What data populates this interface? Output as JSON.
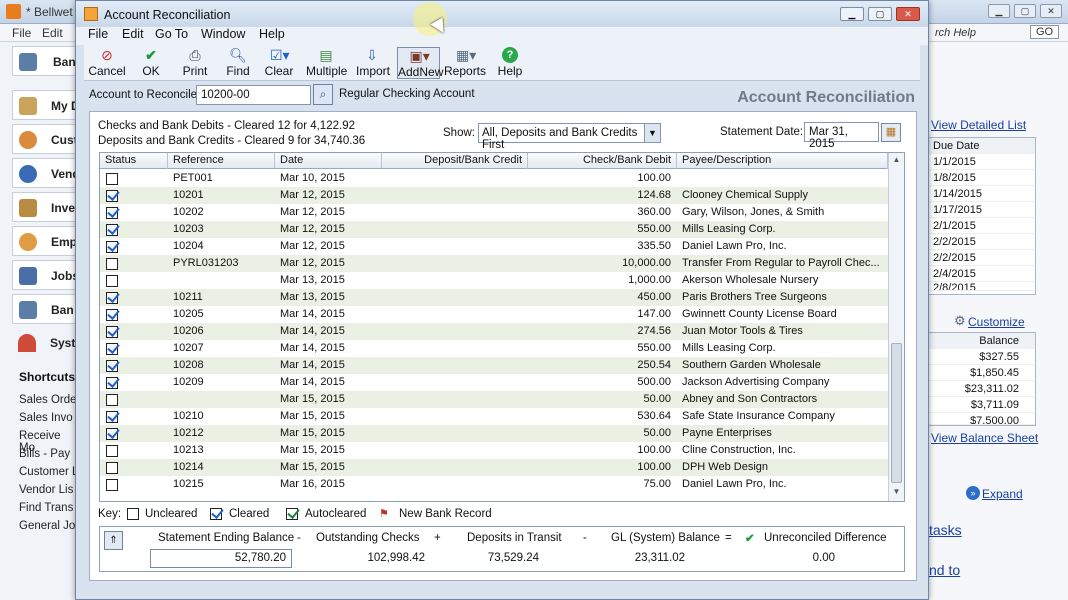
{
  "background_app": {
    "title": "* Bellwet",
    "menu": [
      "File",
      "Edit"
    ],
    "nav_items": [
      "My D",
      "Cust",
      "Vend",
      "Inve",
      "Emp",
      "Jobs",
      "Ban",
      "Syst"
    ],
    "nav_top_label": "Ban",
    "shortcuts_heading": "Shortcuts",
    "shortcuts": [
      "Sales Orde",
      "Sales Invo",
      "Receive Mo",
      "Bills - Pay",
      "Customer L",
      "Vendor Lis",
      "Find Trans",
      "General Jo"
    ],
    "search_help": "rch Help",
    "go_label": "GO",
    "view_detailed_list": "View Detailed List",
    "due_date_header": "Due Date",
    "due_dates": [
      "1/1/2015",
      "1/8/2015",
      "1/14/2015",
      "1/17/2015",
      "2/1/2015",
      "2/2/2015",
      "2/2/2015",
      "2/4/2015",
      "2/8/2015"
    ],
    "customize_label": "Customize",
    "balance_header": "Balance",
    "balances": [
      "$327.55",
      "$1,850.45",
      "$23,311.02",
      "$3,711.09",
      "$7,500.00"
    ],
    "view_balance_sheet": "View Balance Sheet",
    "expand_label": "Expand",
    "tasks_label": "tasks",
    "nd_to_label": "nd to"
  },
  "dialog": {
    "title": "Account Reconciliation",
    "menu": {
      "file": "File",
      "edit": "Edit",
      "goto": "Go To",
      "window": "Window",
      "help": "Help"
    },
    "toolbar": {
      "cancel": "Cancel",
      "ok": "OK",
      "print": "Print",
      "find": "Find",
      "clear": "Clear",
      "multiple": "Multiple",
      "import": "Import",
      "addnew": "AddNew",
      "reports": "Reports",
      "help": "Help"
    },
    "account_label": "Account to Reconcile:",
    "account_value": "10200-00",
    "account_name": "Regular Checking Account",
    "heading": "Account Reconciliation",
    "summary_checks": "Checks and Bank Debits  -  Cleared 12 for 4,122.92",
    "summary_deposits": "Deposits and Bank Credits - Cleared 9 for 34,740.36",
    "show_label": "Show:",
    "show_value": "All, Deposits and Bank Credits First",
    "statement_date_label": "Statement Date:",
    "statement_date": "Mar 31, 2015",
    "columns": {
      "status": "Status",
      "reference": "Reference",
      "date": "Date",
      "deposit": "Deposit/Bank Credit",
      "check": "Check/Bank Debit",
      "payee": "Payee/Description"
    },
    "rows": [
      {
        "cleared": false,
        "ref": "PET001",
        "date": "Mar 10, 2015",
        "deposit": "",
        "check": "100.00",
        "payee": ""
      },
      {
        "cleared": true,
        "ref": "10201",
        "date": "Mar 12, 2015",
        "deposit": "",
        "check": "124.68",
        "payee": "Clooney Chemical Supply"
      },
      {
        "cleared": true,
        "ref": "10202",
        "date": "Mar 12, 2015",
        "deposit": "",
        "check": "360.00",
        "payee": "Gary, Wilson, Jones, & Smith"
      },
      {
        "cleared": true,
        "ref": "10203",
        "date": "Mar 12, 2015",
        "deposit": "",
        "check": "550.00",
        "payee": "Mills Leasing Corp."
      },
      {
        "cleared": true,
        "ref": "10204",
        "date": "Mar 12, 2015",
        "deposit": "",
        "check": "335.50",
        "payee": "Daniel Lawn Pro, Inc."
      },
      {
        "cleared": false,
        "ref": "PYRL031203",
        "date": "Mar 12, 2015",
        "deposit": "",
        "check": "10,000.00",
        "payee": "Transfer From Regular to Payroll Chec..."
      },
      {
        "cleared": false,
        "ref": "",
        "date": "Mar 13, 2015",
        "deposit": "",
        "check": "1,000.00",
        "payee": "Akerson Wholesale Nursery"
      },
      {
        "cleared": true,
        "ref": "10211",
        "date": "Mar 13, 2015",
        "deposit": "",
        "check": "450.00",
        "payee": "Paris Brothers Tree Surgeons"
      },
      {
        "cleared": true,
        "ref": "10205",
        "date": "Mar 14, 2015",
        "deposit": "",
        "check": "147.00",
        "payee": "Gwinnett County License Board"
      },
      {
        "cleared": true,
        "ref": "10206",
        "date": "Mar 14, 2015",
        "deposit": "",
        "check": "274.56",
        "payee": "Juan Motor Tools & Tires"
      },
      {
        "cleared": true,
        "ref": "10207",
        "date": "Mar 14, 2015",
        "deposit": "",
        "check": "550.00",
        "payee": "Mills Leasing Corp."
      },
      {
        "cleared": true,
        "ref": "10208",
        "date": "Mar 14, 2015",
        "deposit": "",
        "check": "250.54",
        "payee": "Southern Garden Wholesale"
      },
      {
        "cleared": true,
        "ref": "10209",
        "date": "Mar 14, 2015",
        "deposit": "",
        "check": "500.00",
        "payee": "Jackson Advertising Company"
      },
      {
        "cleared": false,
        "ref": "",
        "date": "Mar 15, 2015",
        "deposit": "",
        "check": "50.00",
        "payee": "Abney and Son Contractors"
      },
      {
        "cleared": true,
        "ref": "10210",
        "date": "Mar 15, 2015",
        "deposit": "",
        "check": "530.64",
        "payee": "Safe State Insurance Company"
      },
      {
        "cleared": true,
        "ref": "10212",
        "date": "Mar 15, 2015",
        "deposit": "",
        "check": "50.00",
        "payee": "Payne Enterprises"
      },
      {
        "cleared": false,
        "ref": "10213",
        "date": "Mar 15, 2015",
        "deposit": "",
        "check": "100.00",
        "payee": "Cline Construction, Inc."
      },
      {
        "cleared": false,
        "ref": "10214",
        "date": "Mar 15, 2015",
        "deposit": "",
        "check": "100.00",
        "payee": "DPH Web Design"
      },
      {
        "cleared": false,
        "ref": "10215",
        "date": "Mar 16, 2015",
        "deposit": "",
        "check": "75.00",
        "payee": "Daniel Lawn Pro, Inc."
      }
    ],
    "key": {
      "label": "Key:",
      "uncleared": "Uncleared",
      "cleared": "Cleared",
      "autocleared": "Autocleared",
      "new_bank_record": "New Bank Record"
    },
    "totals": {
      "end_balance_label": "Statement Ending Balance",
      "minus1": "-",
      "outstanding_label": "Outstanding Checks",
      "plus": "+",
      "transit_label": "Deposits in Transit",
      "minus2": "-",
      "gl_label": "GL (System) Balance",
      "equals": "=",
      "unreconciled_label": "Unreconciled Difference",
      "end_balance": "52,780.20",
      "outstanding": "102,998.42",
      "transit": "73,529.24",
      "gl": "23,311.02",
      "difference": "0.00"
    }
  }
}
